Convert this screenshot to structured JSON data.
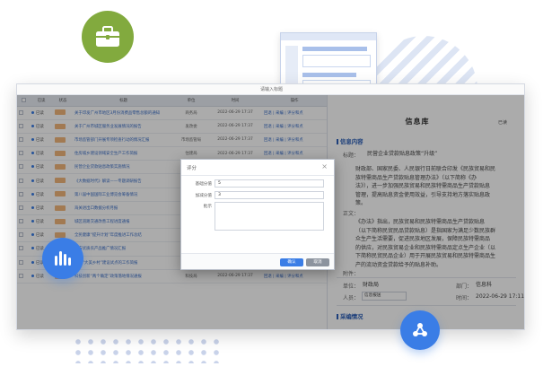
{
  "window": {
    "title": "请输入标题"
  },
  "table": {
    "headers": [
      "",
      "已读",
      "状态",
      "标题",
      "单位",
      "时间",
      "操作"
    ],
    "rows": [
      {
        "read": "已读",
        "title": "关于印发广州市地区3月份消费品零售总额的通知",
        "dept": "商务局",
        "date": "2022-06-29 17:37",
        "ops": "回退 | 采编 | 评分和点"
      },
      {
        "read": "已读",
        "title": "关于广州市城区服务业发展情况的报告",
        "dept": "发改委",
        "date": "2022-06-29 17:37",
        "ops": "回退 | 采编 | 评分和点"
      },
      {
        "read": "已读",
        "title": "市场监管部门开展专项检查行动的情况汇报",
        "dept": "市场监管局",
        "date": "2022-06-29 17:37",
        "ops": "回退 | 采编 | 评分和点"
      },
      {
        "read": "已读",
        "title": "住房城乡建设领域安全生产工作简报",
        "dept": "住建局",
        "date": "2022-06-29 17:37",
        "ops": "回退 | 采编 | 评分和点"
      },
      {
        "read": "已读",
        "title": "民营企业贷款贴息政策实施情况",
        "dept": "财政局",
        "date": "2022-06-29 17:37",
        "ops": "回退 | 采编 | 评分和点"
      },
      {
        "read": "已读",
        "title": "《大数据时代》解读——专题调研报告",
        "dept": "统计局",
        "date": "2022-06-29 17:37",
        "ops": "回退 | 采编 | 评分和点"
      },
      {
        "read": "已读",
        "title": "第八届中国国际工业博览会筹备情况",
        "dept": "工信局",
        "date": "2022-06-29 17:37",
        "ops": "回退 | 采编 | 评分和点"
      },
      {
        "read": "已读",
        "title": "海关进出口数据分析月报",
        "dept": "海关",
        "date": "2022-06-29 17:37",
        "ops": "回退 | 采编 | 评分和点"
      },
      {
        "read": "已读",
        "title": "城区道路交通改善工程进度通报",
        "dept": "交通局",
        "date": "2022-06-29 17:37",
        "ops": "回退 | 采编 | 评分和点"
      },
      {
        "read": "已读",
        "title": "全民健康“提升计划”年度推进工作总结",
        "dept": "卫健委",
        "date": "2022-06-29 17:37",
        "ops": "回退 | 采编 | 评分和点"
      },
      {
        "read": "已读",
        "title": "地方优质农产品推广情况汇报",
        "dept": "农业局",
        "date": "2022-06-29 17:37",
        "ops": "回退 | 采编 | 评分和点"
      },
      {
        "read": "已读",
        "title": "关于“大美乡村”建设试点的工作简报",
        "dept": "乡村振兴局",
        "date": "2022-06-29 17:37",
        "ops": "回退 | 采编 | 评分和点"
      },
      {
        "read": "已读",
        "title": "科技创新“两个确定”政策落地情况通报",
        "dept": "科技局",
        "date": "2022-06-29 17:37",
        "ops": "回退 | 采编 | 评分和点"
      }
    ]
  },
  "detail": {
    "title": "信息库",
    "status": "已读",
    "section_content": "信息内容",
    "label_title": "标题：",
    "title_value": "民营企业贷款贴息政策“升级”",
    "summary_lines": [
      "财政部、国家民委、人民银行日前联合印发《民族贸易和民",
      "族特需商品生产贷款贴息管理办法》（以下简称《办",
      "法》），进一步加强民族贸易和民族特需商品生产贷款贴息",
      "管理，提高贴息资金使用效益，引导支持地方落实贴息政",
      "策。"
    ],
    "label_body": "正文：",
    "body_lines": [
      "《办法》指出，民族贸易和民族特需商品生产贷款贴息",
      "（以下简称民贸民品贷款贴息）是指国家为满足少数民族群",
      "众生产生活需要，促进民族地区发展，保障民族特需商品",
      "的供应，对民族贸易企业和民族特需商品定点生产企业（以",
      "下简称民贸民品企业）用于开展民族贸易和民族特需商品生",
      "产的流动资金贷款给予的贴息补助。"
    ],
    "label_attachment": "附件：",
    "label_unit": "单位：",
    "unit_value": "财政局",
    "label_dept": "部门：",
    "dept_value": "信息科",
    "label_person": "人员：",
    "person_value": "信息报送",
    "label_time": "时间：",
    "time_value": "2022-06-29 17:11",
    "section_adopt": "采编情况"
  },
  "dialog": {
    "title": "评分",
    "basic_score_label": "基础分值",
    "basic_score_value": "5",
    "extra_score_label": "加减分值",
    "extra_score_value": "3",
    "comment_label": "批示",
    "ok_label": "确认",
    "cancel_label": "取消",
    "close_icon": "×"
  },
  "colors": {
    "accent": "#3a7de6",
    "green": "#82aa3e",
    "tag": "#f2b77b"
  }
}
